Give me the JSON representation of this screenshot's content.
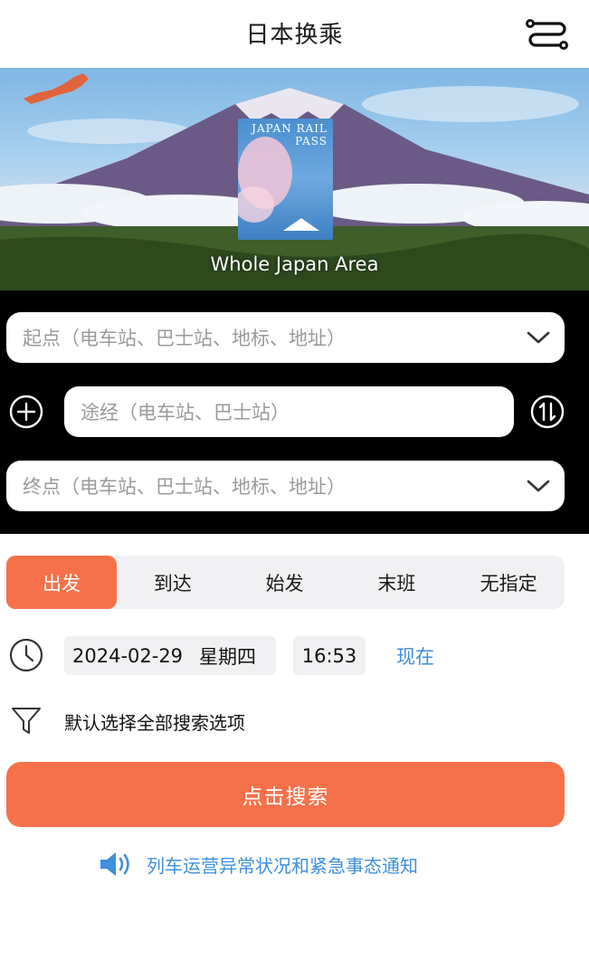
{
  "header": {
    "title": "日本换乘",
    "menu_icon": "route-menu-icon"
  },
  "banner": {
    "pass_text": "JAPAN RAIL PASS",
    "area_label": "Whole Japan Area"
  },
  "search": {
    "origin_placeholder": "起点（电车站、巴士站、地标、地址）",
    "via_placeholder": "途经（电车站、巴士站）",
    "destination_placeholder": "终点（电车站、巴士站、地标、地址）"
  },
  "tabs": [
    {
      "label": "出发",
      "active": true
    },
    {
      "label": "到达",
      "active": false
    },
    {
      "label": "始发",
      "active": false
    },
    {
      "label": "末班",
      "active": false
    },
    {
      "label": "无指定",
      "active": false
    }
  ],
  "datetime": {
    "date": "2024-02-29",
    "weekday": "星期四",
    "time": "16:53",
    "now_label": "现在"
  },
  "filter": {
    "label": "默认选择全部搜索选项"
  },
  "search_button": {
    "label": "点击搜索"
  },
  "notice": {
    "text": "列车运营异常状况和紧急事态通知"
  },
  "colors": {
    "accent": "#f6714a",
    "link": "#3e8fdc",
    "panel": "#000000",
    "tab_bg": "#f1f1f3"
  }
}
